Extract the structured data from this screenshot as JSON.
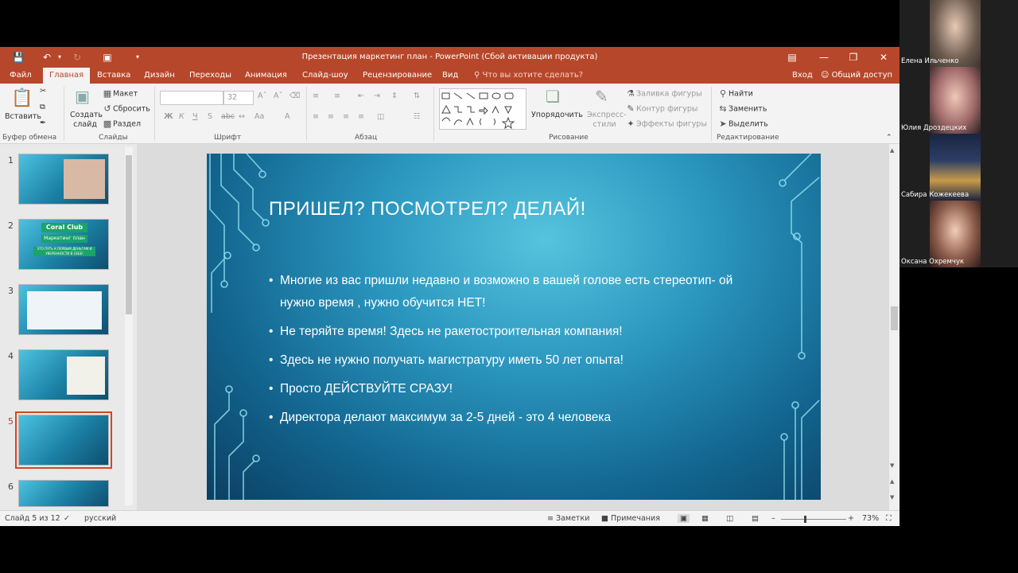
{
  "window": {
    "title": "Презентация маркетинг план - PowerPoint (Сбой активации продукта)"
  },
  "tabs": {
    "file": "Файл",
    "home": "Главная",
    "insert": "Вставка",
    "design": "Дизайн",
    "transitions": "Переходы",
    "animations": "Анимация",
    "slideshow": "Слайд-шоу",
    "review": "Рецензирование",
    "view": "Вид",
    "tellme": "Что вы хотите сделать?",
    "signin": "Вход",
    "share": "Общий доступ"
  },
  "ribbon": {
    "paste": "Вставить",
    "clipboard_group": "Буфер обмена",
    "new_slide": "Создать слайд",
    "layout": "Макет",
    "reset": "Сбросить",
    "section": "Раздел",
    "slides_group": "Слайды",
    "font_size": "32",
    "font_group": "Шрифт",
    "bold": "Ж",
    "italic": "К",
    "underline": "Ч",
    "strike": "S",
    "paragraph_group": "Абзац",
    "arrange": "Упорядочить",
    "quick_styles": "Экспресс-стили",
    "shape_fill": "Заливка фигуры",
    "shape_outline": "Контур фигуры",
    "shape_effects": "Эффекты фигуры",
    "drawing_group": "Рисование",
    "find": "Найти",
    "replace": "Заменить",
    "select": "Выделить",
    "editing_group": "Редактирование"
  },
  "thumbnails": [
    {
      "num": "1",
      "selected": false
    },
    {
      "num": "2",
      "selected": false,
      "title": "Coral Club",
      "subtitle": "Маркетинг план",
      "tagline": "ЭТО ПУТЬ К ПЕРВЫМ ДЕНЬГАМ И УВЕРЕННОСТИ В СЕБЕ!"
    },
    {
      "num": "3",
      "selected": false
    },
    {
      "num": "4",
      "selected": false
    },
    {
      "num": "5",
      "selected": true
    },
    {
      "num": "6",
      "selected": false
    }
  ],
  "slide": {
    "title": "ПРИШЕЛ? ПОСМОТРЕЛ? ДЕЛАЙ!",
    "bullets": [
      "Многие из вас пришли недавно и возможно в вашей голове есть стереотип- ой нужно время , нужно обучится НЕТ!",
      "Не теряйте время! Здесь не ракетостроительная компания!",
      "Здесь не нужно получать магистратуру иметь 50 лет опыта!",
      "Просто ДЕЙСТВУЙТЕ СРАЗУ!",
      "Директора делают максимум за 2-5 дней - это 4 человека"
    ]
  },
  "status": {
    "slide_counter": "Слайд 5 из 12",
    "language": "русский",
    "notes": "Заметки",
    "comments": "Примечания",
    "zoom": "73%",
    "zoom_fraction": 0.73
  },
  "participants": [
    {
      "name": "Елена Ильченко",
      "color": "#6b5a4e"
    },
    {
      "name": "Юлия Дроздецких",
      "color": "#a06a6a"
    },
    {
      "name": "Сабира Кожекеева",
      "color": "#1a2440"
    },
    {
      "name": "Оксана Охремчук",
      "color": "#8a5a48"
    }
  ]
}
